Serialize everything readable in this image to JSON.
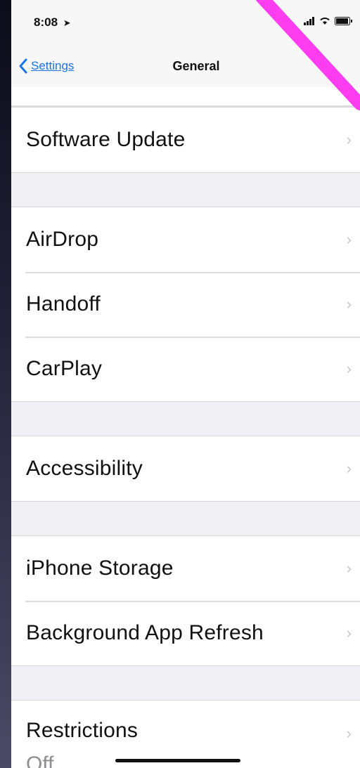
{
  "status_bar": {
    "time": "8:08",
    "location_icon": "location-arrow-icon",
    "signal_icon": "signal-bars-icon",
    "wifi_icon": "wifi-icon",
    "battery_icon": "battery-icon"
  },
  "nav": {
    "back_label": "Settings",
    "title": "General"
  },
  "groups": [
    {
      "rows": [
        {
          "label": "Software Update"
        }
      ]
    },
    {
      "rows": [
        {
          "label": "AirDrop"
        },
        {
          "label": "Handoff"
        },
        {
          "label": "CarPlay"
        }
      ]
    },
    {
      "rows": [
        {
          "label": "Accessibility"
        }
      ]
    },
    {
      "rows": [
        {
          "label": "iPhone Storage"
        },
        {
          "label": "Background App Refresh"
        }
      ]
    },
    {
      "rows": [
        {
          "label": "Restrictions",
          "value": "Off"
        }
      ]
    }
  ],
  "colors": {
    "accent": "#1a73e8",
    "annotation": "#ff3df0",
    "chevron": "#c7c7cc",
    "group_background": "#efeff4"
  }
}
